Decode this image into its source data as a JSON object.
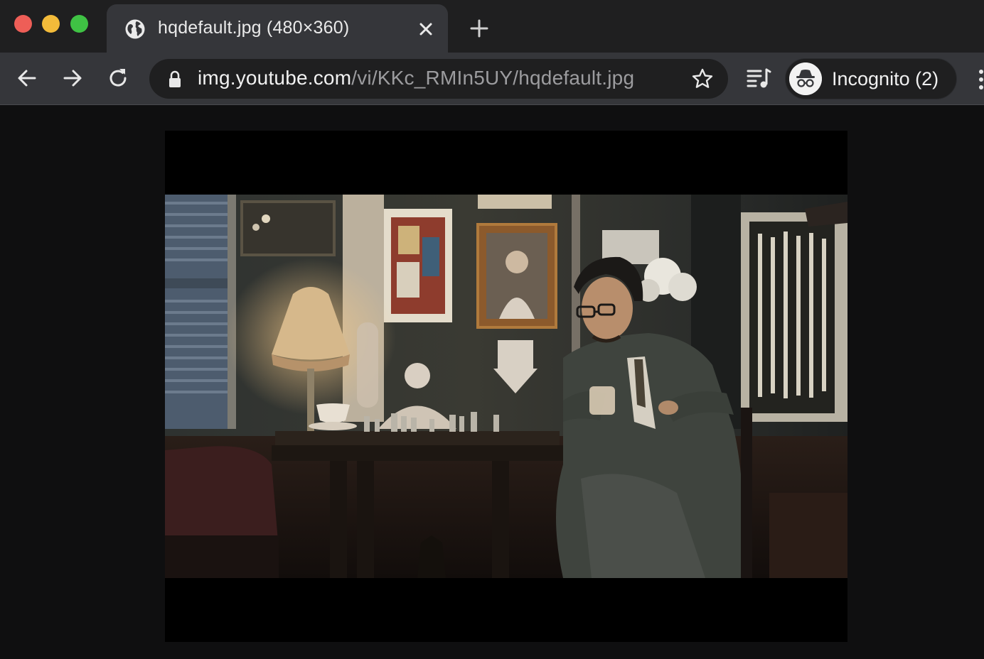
{
  "window": {
    "controls": [
      "close",
      "minimize",
      "maximize"
    ],
    "colors": {
      "close": "#ee5e57",
      "minimize": "#f3bb3a",
      "maximize": "#3fc244"
    }
  },
  "tab": {
    "title": "hqdefault.jpg (480×360)",
    "favicon": "globe-icon",
    "close_icon": "close-icon"
  },
  "new_tab_icon": "plus-icon",
  "toolbar": {
    "back_icon": "arrow-left-icon",
    "forward_icon": "arrow-right-icon",
    "reload_icon": "reload-icon",
    "omnibox": {
      "lock_icon": "lock-icon",
      "url_host": "img.youtube.com",
      "url_path": "/vi/KKc_RMIn5UY/hqdefault.jpg",
      "bookmark_icon": "star-icon"
    },
    "media_icon": "media-queue-icon",
    "profile": {
      "label": "Incognito (2)",
      "icon": "incognito-icon"
    },
    "menu_icon": "kebab-menu-icon"
  },
  "content": {
    "image": {
      "description_type": "photo",
      "subject": "man in suit sitting at chess table holding a teacup"
    }
  },
  "colors": {
    "tabstrip_bg": "#1f1f20",
    "toolbar_bg": "#35363a",
    "omnibox_bg": "#1f1f20",
    "page_bg": "#0f0f10"
  }
}
